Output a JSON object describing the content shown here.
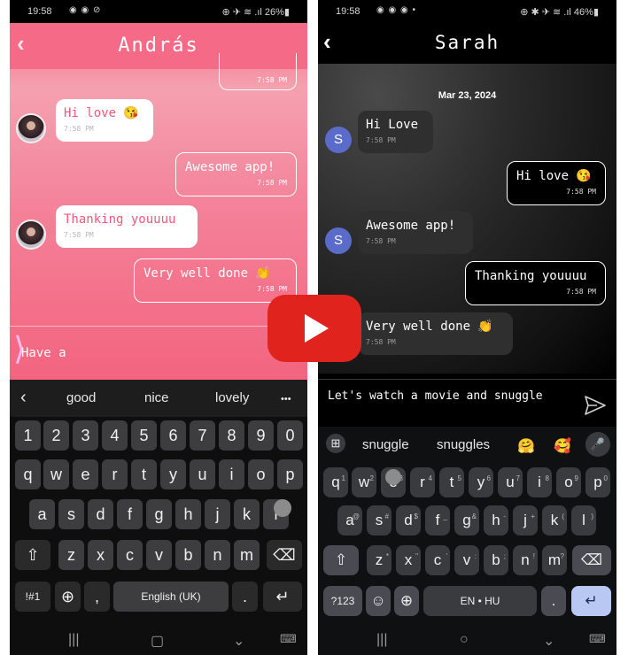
{
  "left": {
    "status": {
      "time": "19:58",
      "icons": "◉ ◉ ⊘",
      "right": "⊕ ✈ ≋ .ıl 26%▮"
    },
    "chat": {
      "title": "András",
      "back_icon": "‹",
      "top_time": "7:58 PM",
      "messages": [
        {
          "dir": "in",
          "text": "Hi love 😘",
          "time": "7:58 PM"
        },
        {
          "dir": "out",
          "text": "Awesome app!",
          "time": "7:58 PM"
        },
        {
          "dir": "in",
          "text": "Thanking youuuu",
          "time": "7:58 PM"
        },
        {
          "dir": "out",
          "text": "Very well done 👏",
          "time": "7:58 PM"
        }
      ],
      "input_value": "Have a",
      "input_arrow": "⟩"
    },
    "keyboard": {
      "suggestions": [
        "good",
        "nice",
        "lovely"
      ],
      "suggest_back": "‹",
      "more": "•••",
      "row_numbers": [
        "1",
        "2",
        "3",
        "4",
        "5",
        "6",
        "7",
        "8",
        "9",
        "0"
      ],
      "row1": [
        "q",
        "w",
        "e",
        "r",
        "t",
        "y",
        "u",
        "i",
        "o",
        "p"
      ],
      "row2": [
        "a",
        "s",
        "d",
        "f",
        "g",
        "h",
        "j",
        "k",
        "l"
      ],
      "row3": [
        "z",
        "x",
        "c",
        "v",
        "b",
        "n",
        "m"
      ],
      "shift": "⇧",
      "backspace": "⌫",
      "symbols": "!#1",
      "globe": "⊕",
      "comma": ",",
      "space": "English (UK)",
      "period": ".",
      "enter": "↵"
    },
    "nav": {
      "recent": "|||",
      "home": "▢",
      "back": "⌄",
      "keyboard": "⌨"
    }
  },
  "right": {
    "status": {
      "time": "19:58",
      "icons": "◉ ◉ ◉ •",
      "right": "⊕ ✱ ✈ ≋ .ıl 46%▮"
    },
    "chat": {
      "title": "Sarah",
      "back_icon": "‹",
      "date": "Mar 23, 2024",
      "avatar_letter": "S",
      "messages": [
        {
          "dir": "in",
          "text": "Hi Love",
          "time": "7:58 PM"
        },
        {
          "dir": "out",
          "text": "Hi love 😘",
          "time": "7:58 PM"
        },
        {
          "dir": "in",
          "text": "Awesome app!",
          "time": "7:58 PM"
        },
        {
          "dir": "out",
          "text": "Thanking youuuu",
          "time": "7:58 PM"
        },
        {
          "dir": "in",
          "text": "Very well done 👏",
          "time": "7:58 PM"
        }
      ],
      "compose_value": "Let's watch a movie and snuggle"
    },
    "keyboard": {
      "grid_icon": "⊞",
      "suggestions": [
        "snuggle",
        "snuggles"
      ],
      "emoji1": "🤗",
      "emoji2": "🥰",
      "mic_icon": "🎤",
      "row1": [
        "q",
        "w",
        "e",
        "r",
        "t",
        "y",
        "u",
        "i",
        "o",
        "p"
      ],
      "row1_sup": [
        "1",
        "2",
        "3",
        "4",
        "5",
        "6",
        "7",
        "8",
        "9",
        "0"
      ],
      "row2": [
        "a",
        "s",
        "d",
        "f",
        "g",
        "h",
        "j",
        "k",
        "l"
      ],
      "row2_sup": [
        "@",
        "#",
        "$",
        "_",
        "&",
        "-",
        "+",
        "(",
        ")"
      ],
      "row3": [
        "z",
        "x",
        "c",
        "v",
        "b",
        "n",
        "m"
      ],
      "row3_sup": [
        "*",
        "\"",
        "'",
        ":",
        ";",
        "!",
        "?"
      ],
      "shift": "⇧",
      "backspace": "⌫",
      "symbols": "?123",
      "emoji_key": "☺",
      "globe": "⊕",
      "space": "EN • HU",
      "period": ".",
      "enter": "↵"
    },
    "nav": {
      "recent": "|||",
      "home": "○",
      "back": "⌄",
      "keyboard": "⌨"
    }
  },
  "video": {
    "play_icon": "play-triangle"
  }
}
